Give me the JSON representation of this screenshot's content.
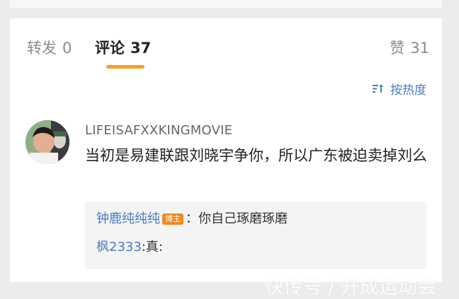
{
  "tabs": {
    "repost_label": "转发",
    "repost_count": "0",
    "comments_label": "评论",
    "comments_count": "37",
    "likes_label": "赞",
    "likes_count": "31"
  },
  "sort": {
    "label": "按热度",
    "icon": "sort-icon"
  },
  "comment": {
    "username": "LIFEISAFXXKINGMOVIE",
    "text": "当初是易建联跟刘晓宇争你，所以广东被迫卖掉刘么"
  },
  "replies": [
    {
      "user": "钟鹿纯纯纯",
      "badge": "博主",
      "sep": "：",
      "text": "你自己琢磨琢磨"
    },
    {
      "user": "枫2333",
      "sep": ":",
      "text": "真:"
    }
  ],
  "watermark": "快传号 / 开成运动会",
  "colors": {
    "accent": "#f7a01d",
    "link": "#4a7cc1",
    "badge": "#f08a1c"
  }
}
